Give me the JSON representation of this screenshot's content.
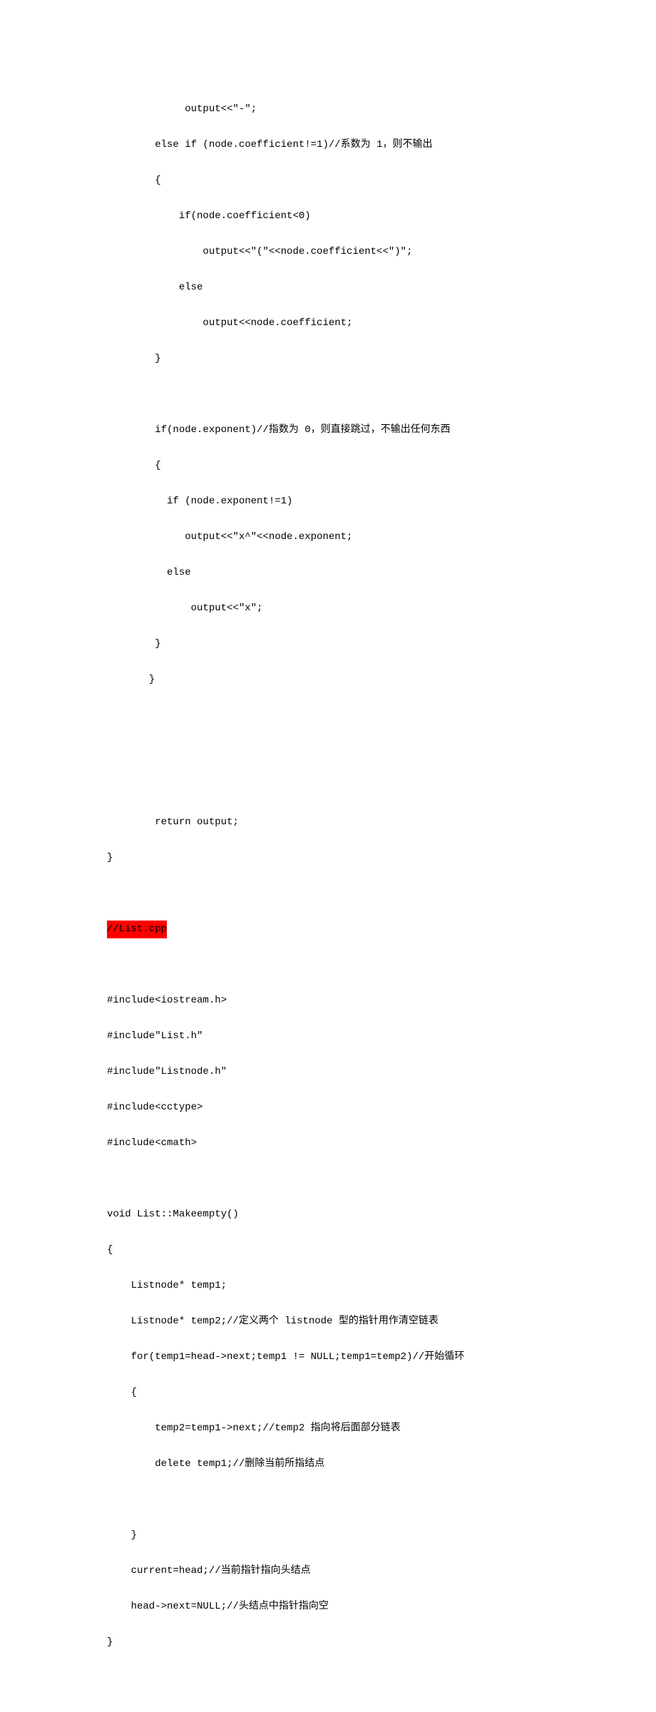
{
  "lines": {
    "l01": "             output<<\"-\";",
    "l02": "        else if (node.coefficient!=1)//系数为 1，则不输出",
    "l03": "        {",
    "l04": "            if(node.coefficient<0)",
    "l05": "                output<<\"(\"<<node.coefficient<<\")\";",
    "l06": "            else",
    "l07": "                output<<node.coefficient;",
    "l08": "        }",
    "l09": "        if(node.exponent)//指数为 0，则直接跳过，不输出任何东西",
    "l10": "        {",
    "l11": "          if (node.exponent!=1)",
    "l12": "             output<<\"x^\"<<node.exponent;",
    "l13": "          else",
    "l14": "              output<<\"x\";",
    "l15": "        }",
    "l16": "       }",
    "l17": "        return output;",
    "l18": "}",
    "highlight": "//List.cpp",
    "l19": "#include<iostream.h>",
    "l20": "#include\"List.h\"",
    "l21": "#include\"Listnode.h\"",
    "l22": "#include<cctype>",
    "l23": "#include<cmath>",
    "l24": "void List::Makeempty()",
    "l25": "{",
    "l26": "    Listnode* temp1;",
    "l27": "    Listnode* temp2;//定义两个 listnode 型的指针用作清空链表",
    "l28": "    for(temp1=head->next;temp1 != NULL;temp1=temp2)//开始循环",
    "l29": "    {",
    "l30": "        temp2=temp1->next;//temp2 指向将后面部分链表",
    "l31": "        delete temp1;//删除当前所指结点",
    "l32": "    }",
    "l33": "    current=head;//当前指针指向头结点",
    "l34": "    head->next=NULL;//头结点中指针指向空",
    "l35": "}"
  }
}
